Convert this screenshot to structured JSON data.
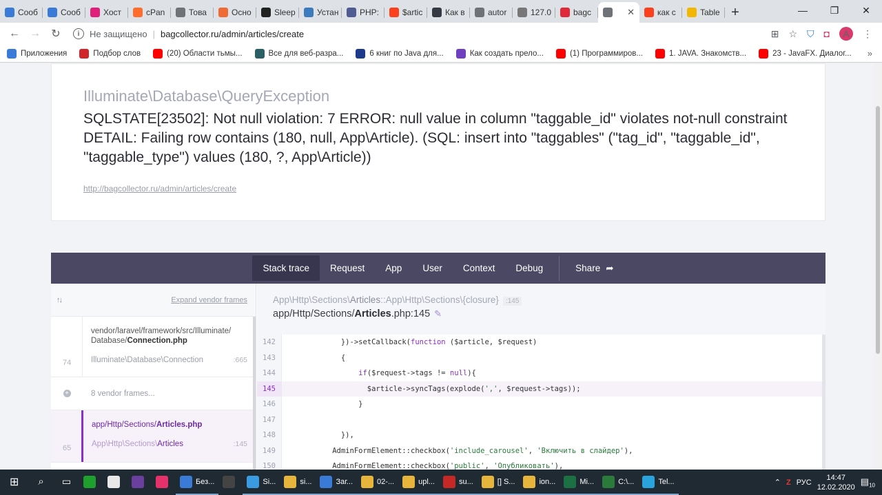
{
  "tabs": [
    {
      "label": "Сооб",
      "color": "#3b7bd8",
      "icon": "square-icon"
    },
    {
      "label": "Сооб",
      "color": "#3b7bd8",
      "icon": "square-icon"
    },
    {
      "label": "Хост",
      "color": "#e0207a",
      "icon": "heart-icon"
    },
    {
      "label": "cPan",
      "color": "#ff6c2c",
      "icon": "cpanel-icon"
    },
    {
      "label": "Това",
      "color": "#6f7378",
      "icon": "globe-icon"
    },
    {
      "label": "Осно",
      "color": "#f06a35",
      "icon": "stack-icon"
    },
    {
      "label": "Sleep",
      "color": "#222222",
      "icon": "github-icon"
    },
    {
      "label": "Устан",
      "color": "#3c7bbd",
      "icon": "doc-icon"
    },
    {
      "label": "PHP:",
      "color": "#4f5b93",
      "icon": "php-icon"
    },
    {
      "label": "$artic",
      "color": "#fc3f1d",
      "icon": "yandex-icon"
    },
    {
      "label": "Как в",
      "color": "#333a44",
      "icon": "dark-square-icon"
    },
    {
      "label": "autor",
      "color": "#6f7378",
      "icon": "globe-icon"
    },
    {
      "label": "127.0",
      "color": "#777777",
      "icon": "pg-icon"
    },
    {
      "label": "bagc",
      "color": "#e02a3a",
      "icon": "laravel-icon"
    },
    {
      "label": "",
      "color": "#6f7378",
      "icon": "globe-icon",
      "active": true
    },
    {
      "label": "как с",
      "color": "#fc3f1d",
      "icon": "yandex-icon"
    },
    {
      "label": "Table",
      "color": "#f2b705",
      "icon": "tables-icon"
    }
  ],
  "window_controls": {
    "minimize": "—",
    "maximize": "❐",
    "close": "✕"
  },
  "toolbar": {
    "back": "←",
    "forward": "→",
    "reload": "↻",
    "security_label": "Не защищено",
    "url": "bagcollector.ru/admin/articles/create",
    "avatar_letter": "A"
  },
  "bookmarks": [
    {
      "label": "Приложения",
      "color": "#3b7bd8"
    },
    {
      "label": "Подбор слов",
      "color": "#d0262a"
    },
    {
      "label": "(20) Области тьмы...",
      "color": "#ff0000"
    },
    {
      "label": "Все для веб-разра...",
      "color": "#2b5f63"
    },
    {
      "label": "6 книг по Java для...",
      "color": "#1b3a8c"
    },
    {
      "label": "Как создать прело...",
      "color": "#6e3fbf"
    },
    {
      "label": "(1) Программиров...",
      "color": "#ff0000"
    },
    {
      "label": "1. JAVA. Знакомств...",
      "color": "#ff0000"
    },
    {
      "label": "23 - JavaFX. Диалог...",
      "color": "#ff0000"
    }
  ],
  "exception": {
    "class": "Illuminate\\Database\\QueryException",
    "message": "SQLSTATE[23502]: Not null violation: 7 ERROR: null value in column \"taggable_id\" violates not-null constraint DETAIL: Failing row contains (180, null, App\\Article). (SQL: insert into \"taggables\" (\"tag_id\", \"taggable_id\", \"taggable_type\") values (180, ?, App\\Article))",
    "url": "http://bagcollector.ru/admin/articles/create"
  },
  "stack_tabs": [
    "Stack trace",
    "Request",
    "App",
    "User",
    "Context",
    "Debug"
  ],
  "share_label": "Share",
  "frames_panel": {
    "expand_label": "Expand vendor frames",
    "frame1": {
      "num": "74",
      "path_prefix": "vendor/laravel/framework/src/Illuminate/",
      "path_dir": "Database/",
      "file": "Connection.php",
      "class": "Illuminate\\Database\\Connection",
      "line": ":665"
    },
    "vendor_label": "8 vendor frames...",
    "frame2": {
      "num": "65",
      "path_prefix": "app/Http/Sections/",
      "file": "Articles.php",
      "class_prefix": "App\\Http\\Sections\\",
      "class_name": "Articles",
      "line": ":145"
    }
  },
  "code_view": {
    "class_prefix": "App\\Http\\Sections\\",
    "class_name": "Articles",
    "method": "::App\\Http\\Sections\\{closure}",
    "line_badge": ":145",
    "file_prefix": "app/Http/Sections/",
    "file_name": "Articles",
    "file_suffix": ".php:145",
    "lines": [
      {
        "n": "142",
        "code": "            })->setCallback(function ($article, $request)"
      },
      {
        "n": "143",
        "code": "            {"
      },
      {
        "n": "144",
        "code": "                if($request->tags != null){"
      },
      {
        "n": "145",
        "code": "                  $article->syncTags(explode(',', $request->tags));",
        "highlight": true
      },
      {
        "n": "146",
        "code": "                }"
      },
      {
        "n": "147",
        "code": ""
      },
      {
        "n": "148",
        "code": "            }),"
      },
      {
        "n": "149",
        "code": "          AdminFormElement::checkbox('include_carousel', 'Включить в слайдер'),"
      },
      {
        "n": "150",
        "code": "          AdminFormElement::checkbox('public', 'Опубликовать'),"
      }
    ]
  },
  "taskbar": {
    "items": [
      {
        "label": "",
        "color": "#1fa02e",
        "icon": "pycharm-icon"
      },
      {
        "label": "",
        "color": "#e8e8e8",
        "icon": "yandex-browser-icon"
      },
      {
        "label": "",
        "color": "#6a3fa0",
        "icon": "phpstorm-icon"
      },
      {
        "label": "",
        "color": "#e5326b",
        "icon": "intellij-icon"
      },
      {
        "label": "Без...",
        "color": "#3b7bd8",
        "icon": "window-icon",
        "open": true
      },
      {
        "label": "",
        "color": "#444",
        "icon": "nox-icon"
      },
      {
        "label": "Si...",
        "color": "#3b9be0",
        "icon": "virtualbox-icon",
        "open": true
      },
      {
        "label": "si...",
        "color": "#e8b53c",
        "icon": "folder-icon",
        "open": true
      },
      {
        "label": "Заг...",
        "color": "#3b7bd8",
        "icon": "download-icon",
        "open": true
      },
      {
        "label": "02-...",
        "color": "#e8b53c",
        "icon": "folder-icon",
        "open": true
      },
      {
        "label": "upl...",
        "color": "#e8b53c",
        "icon": "folder-icon",
        "open": true
      },
      {
        "label": "su...",
        "color": "#c62828",
        "icon": "filezilla-icon",
        "open": true
      },
      {
        "label": "[] S...",
        "color": "#e8b53c",
        "icon": "chrome-icon",
        "open": true
      },
      {
        "label": "ion...",
        "color": "#e8b53c",
        "icon": "chrome-icon",
        "open": true
      },
      {
        "label": "Mi...",
        "color": "#1d7044",
        "icon": "excel-icon",
        "open": true
      },
      {
        "label": "C:\\...",
        "color": "#2c7a3b",
        "icon": "notepad-icon",
        "open": true
      },
      {
        "label": "Tel...",
        "color": "#2aa3dd",
        "icon": "telegram-icon",
        "open": true
      }
    ],
    "tray_lang": "РУС",
    "time": "14:47",
    "date": "12.02.2020",
    "notif_count": "10"
  }
}
